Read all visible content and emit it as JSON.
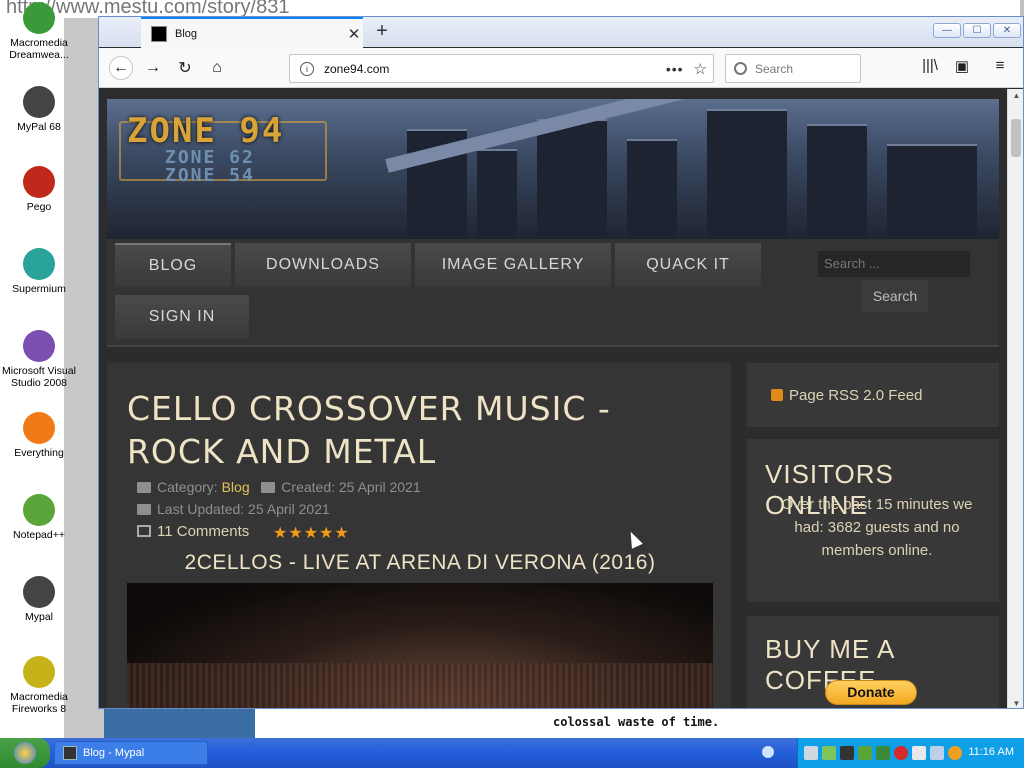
{
  "desktop": {
    "icons": [
      {
        "label": "Macromedia Dreamwea...",
        "color": "#3a9a3a"
      },
      {
        "label": "MyPal 68",
        "color": "#444444"
      },
      {
        "label": "Pego",
        "color": "#c0281c"
      },
      {
        "label": "Supermium",
        "color": "#2aa39a"
      },
      {
        "label": "Microsoft Visual Studio 2008",
        "color": "#7a4fb0"
      },
      {
        "label": "Everything",
        "color": "#f07a16"
      },
      {
        "label": "Notepad++",
        "color": "#5aa53a"
      },
      {
        "label": "Mypal",
        "color": "#444444"
      },
      {
        "label": "Macromedia Fireworks 8",
        "color": "#c8b21a"
      }
    ]
  },
  "background_browser": {
    "url_text": "http://www.mestu.com/story/831",
    "bottom_text": "colossal waste of time."
  },
  "window": {
    "tab_title": "Blog",
    "url": "zone94.com",
    "search_placeholder": "Search",
    "controls": {
      "minimize": "—",
      "maximize": "☐",
      "close": "✕"
    }
  },
  "site": {
    "logo_main": "ZONE 94",
    "logo_sub1": "ZONE 62",
    "logo_sub2": "ZONE 54",
    "menu": [
      "BLOG",
      "DOWNLOADS",
      "IMAGE GALLERY",
      "QUACK IT",
      "SIGN IN"
    ],
    "search_placeholder": "Search ...",
    "search_button": "Search"
  },
  "article": {
    "title": "CELLO CROSSOVER MUSIC - ROCK AND METAL",
    "category_label": "Category:",
    "category": "Blog",
    "created": "Created: 25 April 2021",
    "updated": "Last Updated: 25 April 2021",
    "comments": "11 Comments",
    "rating_stars": "★★★★★",
    "subtitle": "2CELLOS - LIVE AT ARENA DI VERONA (2016)"
  },
  "sidebar": {
    "rss": "Page RSS 2.0 Feed",
    "visitors_title": "VISITORS ONLINE",
    "visitors_text": "Over the past 15 minutes we had: 3682 guests and no members online.",
    "coffee_title": "BUY ME A COFFEE",
    "donate_label": "Donate"
  },
  "taskbar": {
    "task_label": "Blog - Mypal",
    "clock": "11:16 AM"
  }
}
